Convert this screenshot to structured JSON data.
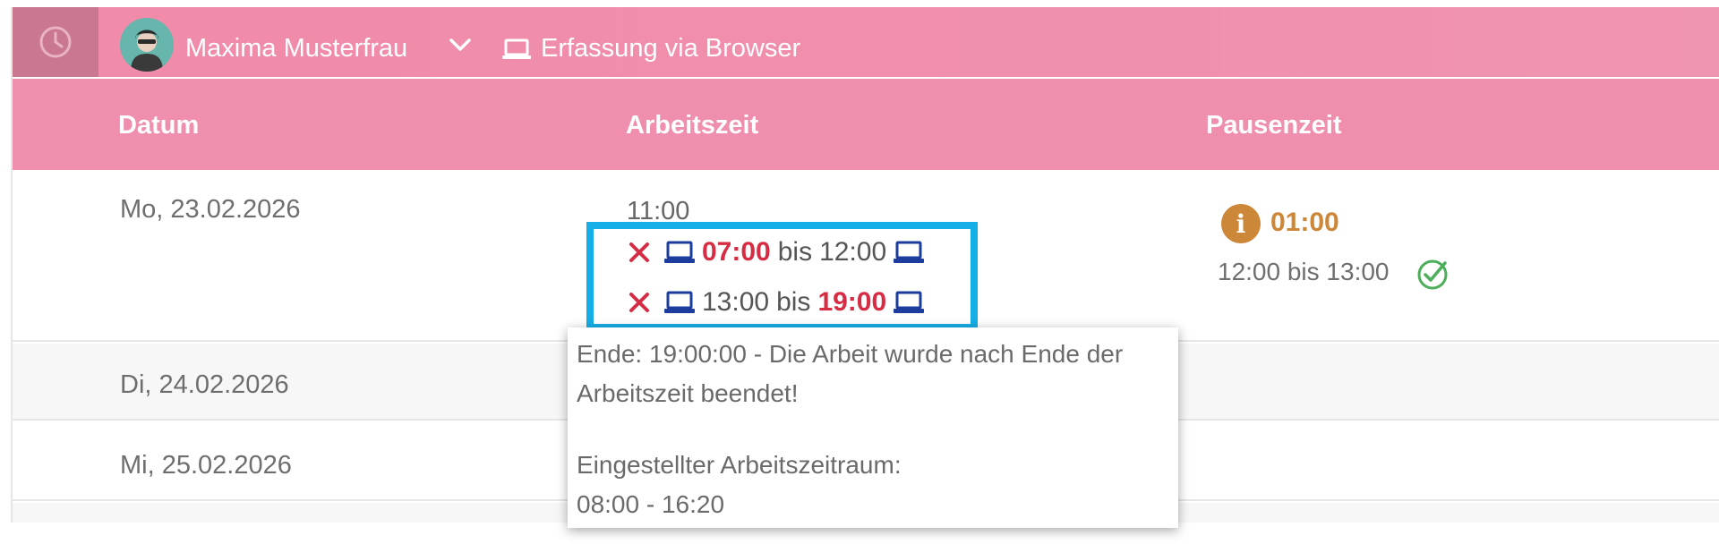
{
  "header": {
    "user_name": "Maxima Musterfrau",
    "capture_mode": "Erfassung via Browser"
  },
  "table": {
    "columns": [
      "Datum",
      "Arbeitszeit",
      "Pausenzeit"
    ],
    "rows": [
      {
        "date": "Mo, 23.02.2026",
        "work_total": "11:00",
        "segments": [
          {
            "start": "07:00",
            "sep": "bis",
            "end": "12:00",
            "start_flag": true,
            "end_flag": false
          },
          {
            "start": "13:00",
            "sep": "bis",
            "end": "19:00",
            "start_flag": false,
            "end_flag": true
          }
        ],
        "pause_duration": "01:00",
        "pause_span": "12:00 bis 13:00"
      },
      {
        "date": "Di, 24.02.2026"
      },
      {
        "date": "Mi, 25.02.2026"
      }
    ]
  },
  "tooltip": {
    "line1": "Ende: 19:00:00 - Die Arbeit wurde nach Ende der",
    "line2": "Arbeitszeit beendet!",
    "line3": "Eingestellter Arbeitszeitraum:",
    "line4": "08:00 - 16:20"
  },
  "colors": {
    "header_pink": "#f08fad",
    "clock_button": "#c9788f",
    "flag_red": "#d62d44",
    "device_blue": "#1c3d9e",
    "pause_orange": "#cd8738",
    "ok_green": "#4cae5a",
    "highlight_blue": "#16aee6"
  },
  "icons": {
    "clock": "clock-icon",
    "user_menu": "chevron-down-icon",
    "device": "laptop-icon",
    "violation": "x-mark-icon",
    "info": "info-icon",
    "ok": "check-circle-icon"
  }
}
